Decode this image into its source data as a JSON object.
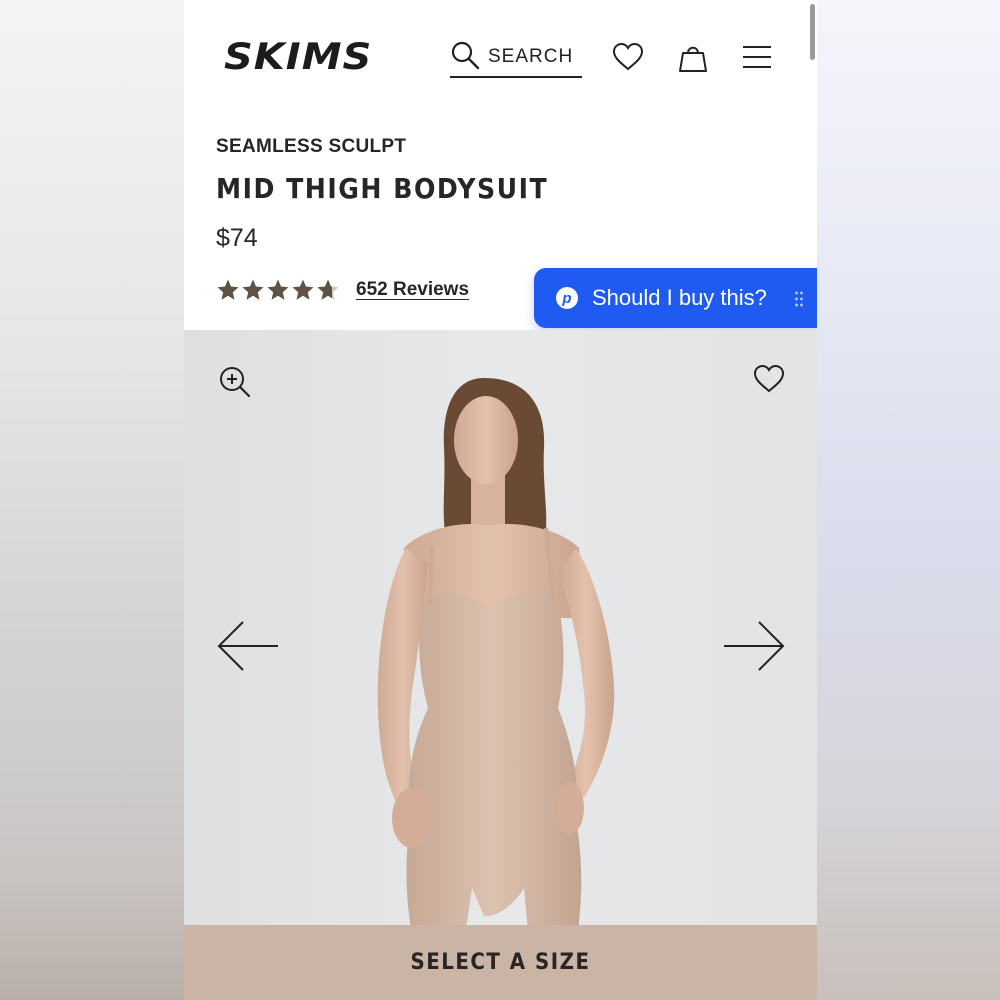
{
  "header": {
    "logo_text": "SKIMS",
    "search_label": "SEARCH",
    "icons": [
      "search-icon",
      "heart-icon",
      "bag-icon",
      "menu-icon"
    ]
  },
  "product": {
    "collection": "SEAMLESS SCULPT",
    "title": "MID THIGH BODYSUIT",
    "price": "$74",
    "rating": 4.5,
    "rating_max": 5,
    "reviews_label": "652 Reviews"
  },
  "assistant": {
    "label": "Should I buy this?",
    "icon": "p-logo-icon",
    "color": "#1f5bf0"
  },
  "gallery": {
    "icons": [
      "zoom-in-icon",
      "wishlist-heart-icon",
      "arrow-left-icon",
      "arrow-right-icon"
    ]
  },
  "cta": {
    "label": "SELECT A SIZE",
    "color": "#c9b4a5"
  },
  "colors": {
    "star": "#5e5246",
    "text": "#262626"
  }
}
